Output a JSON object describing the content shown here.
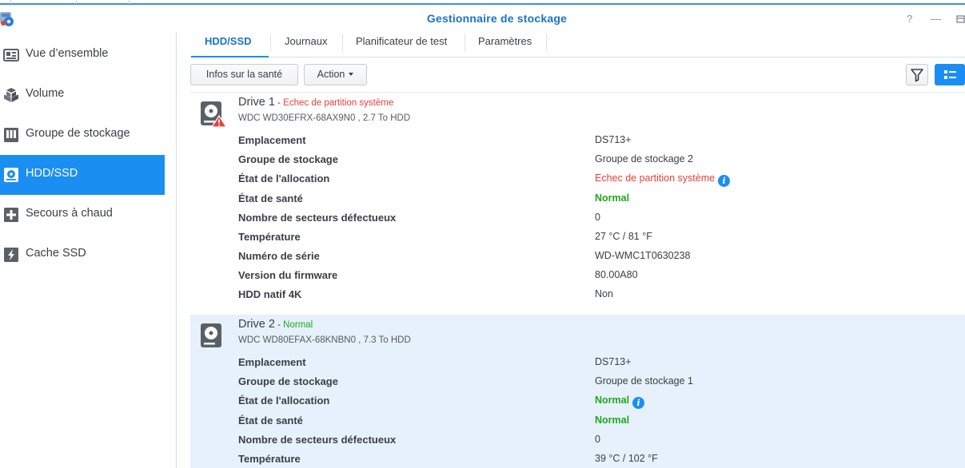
{
  "window": {
    "title": "Gestionnaire de stockage",
    "help_glyph": "?",
    "minimize_glyph": "—",
    "close_glyph": "×"
  },
  "colors": {
    "accent": "#1b8ef2",
    "title": "#1a73c8",
    "error": "#e8403a",
    "ok": "#1ea81e",
    "selected_row": "#e6f1fb"
  },
  "sidebar": {
    "items": [
      {
        "label": "Vue d’ensemble",
        "icon": "overview-icon"
      },
      {
        "label": "Volume",
        "icon": "volume-icon"
      },
      {
        "label": "Groupe de stockage",
        "icon": "storage-pool-icon"
      },
      {
        "label": "HDD/SSD",
        "icon": "hdd-icon",
        "active": true
      },
      {
        "label": "Secours à chaud",
        "icon": "hot-spare-icon"
      },
      {
        "label": "Cache SSD",
        "icon": "ssd-cache-icon"
      }
    ]
  },
  "tabs": [
    {
      "label": "HDD/SSD",
      "active": true
    },
    {
      "label": "Journaux"
    },
    {
      "label": "Planificateur de test"
    },
    {
      "label": "Paramètres"
    }
  ],
  "toolbar": {
    "health_info_label": "Infos sur la santé",
    "action_label": "Action",
    "filter_icon": "filter-icon",
    "list_view_icon": "list-view-icon"
  },
  "drives": [
    {
      "name": "Drive 1",
      "status": "Echec de partition système",
      "model": "WDC WD30EFRX-68AX9N0 , 2.7 To HDD",
      "warning": true,
      "properties": {
        "location_label": "Emplacement",
        "location": "DS713+",
        "pool_label": "Groupe de stockage",
        "pool": "Groupe de stockage 2",
        "allocation_label": "État de l'allocation",
        "allocation": "Echec de partition système",
        "health_label": "État de santé",
        "health": "Normal",
        "bad_sectors_label": "Nombre de secteurs défectueux",
        "bad_sectors": "0",
        "temperature_label": "Température",
        "temperature": "27 °C / 81 °F",
        "serial_label": "Numéro de série",
        "serial": "WD-WMC1T0630238",
        "firmware_label": "Version du firmware",
        "firmware": "80.00A80",
        "native_4k_label": "HDD natif 4K",
        "native_4k": "Non"
      }
    },
    {
      "name": "Drive 2",
      "status": "Normal",
      "model": "WDC WD80EFAX-68KNBN0 , 7.3 To HDD",
      "warning": false,
      "properties": {
        "location_label": "Emplacement",
        "location": "DS713+",
        "pool_label": "Groupe de stockage",
        "pool": "Groupe de stockage 1",
        "allocation_label": "État de l'allocation",
        "allocation": "Normal",
        "health_label": "État de santé",
        "health": "Normal",
        "bad_sectors_label": "Nombre de secteurs défectueux",
        "bad_sectors": "0",
        "temperature_label": "Température",
        "temperature": "39 °C / 102 °F"
      }
    }
  ],
  "info_glyph": "i",
  "dash": " - "
}
